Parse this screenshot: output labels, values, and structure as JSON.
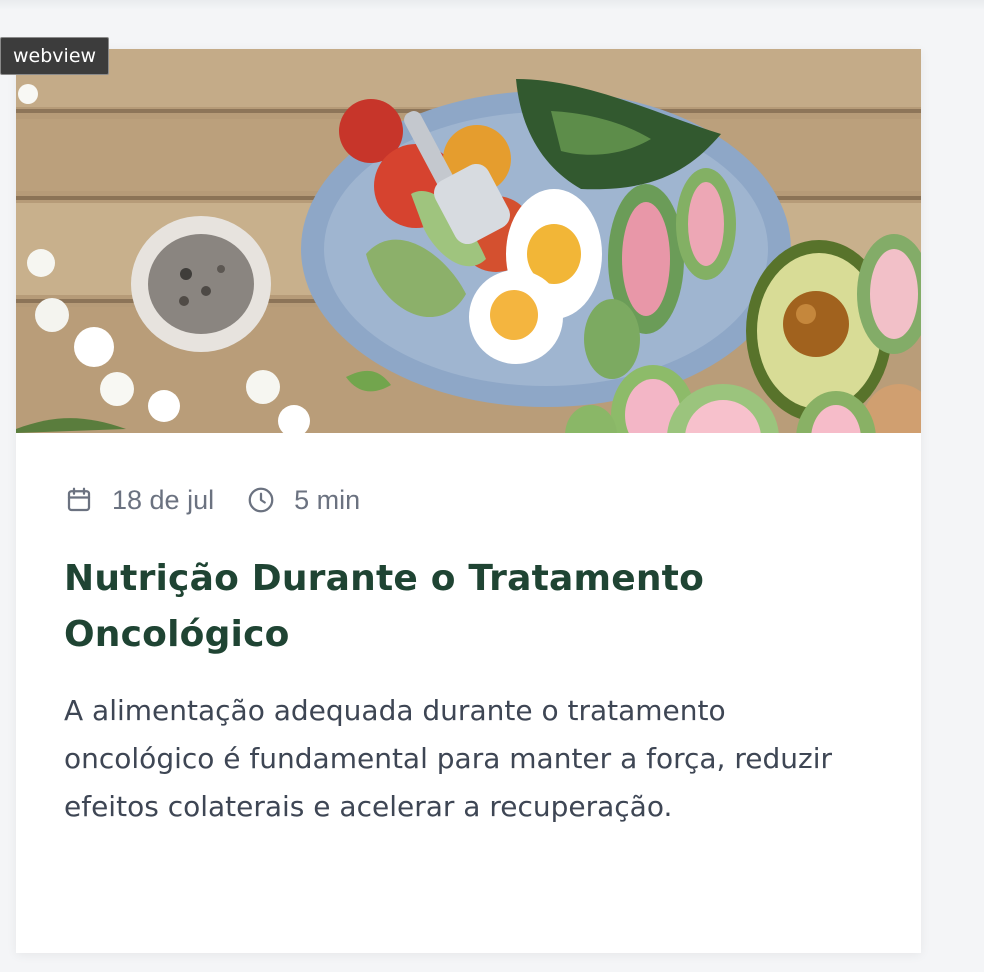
{
  "webview_label": "webview",
  "card": {
    "image_alt": "Prato com ovos cozidos, tomates, legumes, abacate e verduras sobre mesa de madeira",
    "meta": {
      "date": "18 de jul",
      "date_icon": "calendar-icon",
      "read_time": "5 min",
      "time_icon": "clock-icon"
    },
    "title": "Nutrição Durante o Tratamento Oncológico",
    "excerpt": "A alimentação adequada durante o tratamento oncológico é fundamental para manter a força, reduzir efeitos colaterais e acelerar a recuperação."
  },
  "colors": {
    "title": "#1f4433",
    "meta_text": "#6b7280",
    "excerpt_text": "#3e4654",
    "page_background": "#f4f5f7",
    "card_background": "#ffffff"
  }
}
